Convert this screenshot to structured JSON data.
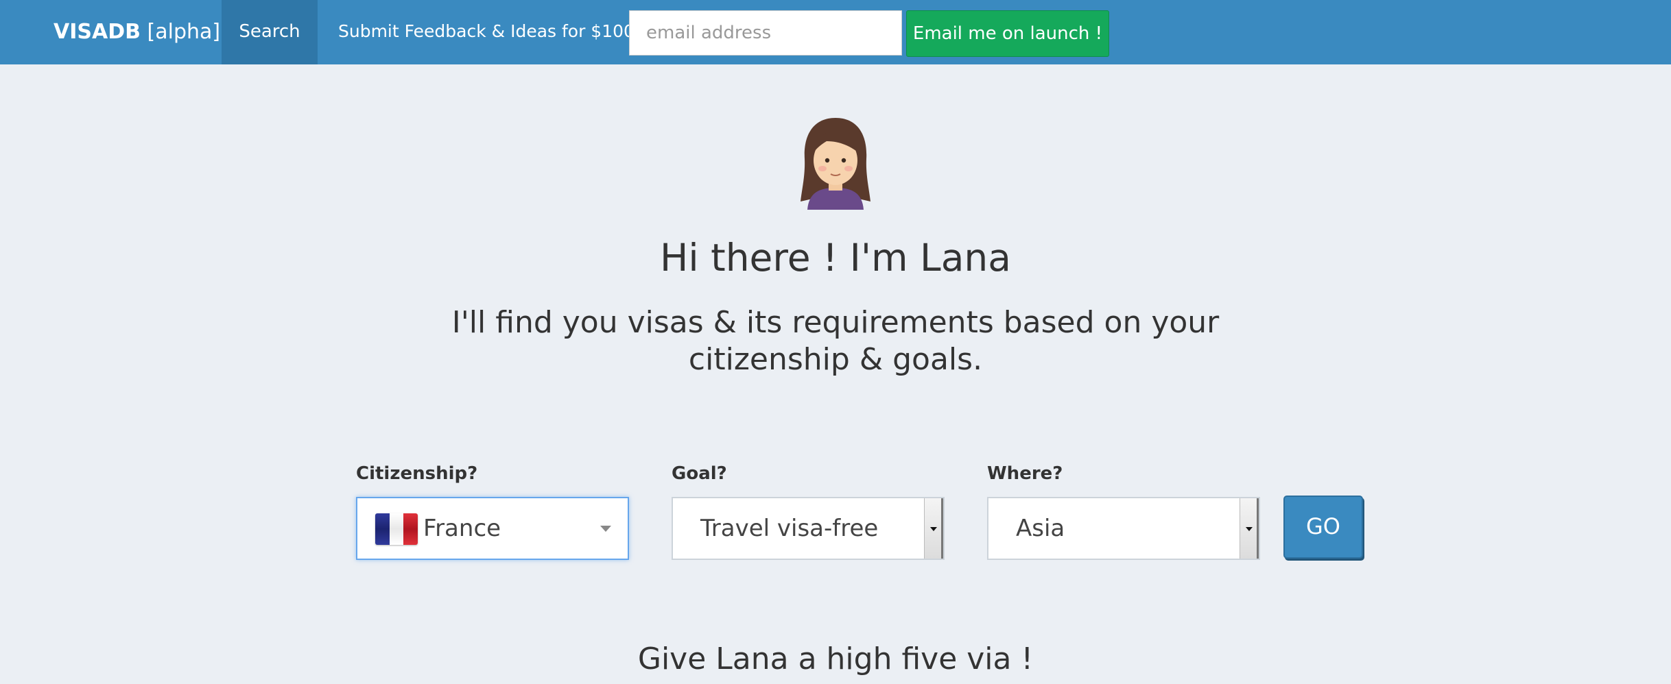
{
  "nav": {
    "brand_name": "VISADB",
    "brand_tag": "[alpha]",
    "search_label": "Search",
    "feedback_label": "Submit Feedback & Ideas for $100",
    "email_placeholder": "email address",
    "email_button_label": "Email me on launch !"
  },
  "hero": {
    "title": "Hi there ! I'm Lana",
    "subtitle": "I'll find you visas & its requirements based on your citizenship & goals."
  },
  "form": {
    "citizenship_label": "Citizenship?",
    "citizenship_value": "France",
    "goal_label": "Goal?",
    "goal_value": "Travel visa-free",
    "where_label": "Where?",
    "where_value": "Asia",
    "go_label": "GO"
  },
  "footer": {
    "title": "Give Lana a high five via !"
  },
  "colors": {
    "navbar": "#3a8ac0",
    "nav_active": "#2f77a8",
    "email_button": "#15a95b",
    "page_background": "#ebeff4",
    "go_button": "#3a8ac0"
  },
  "icons": {
    "avatar": "woman-emoji-avatar",
    "flag": "france-flag-icon"
  }
}
